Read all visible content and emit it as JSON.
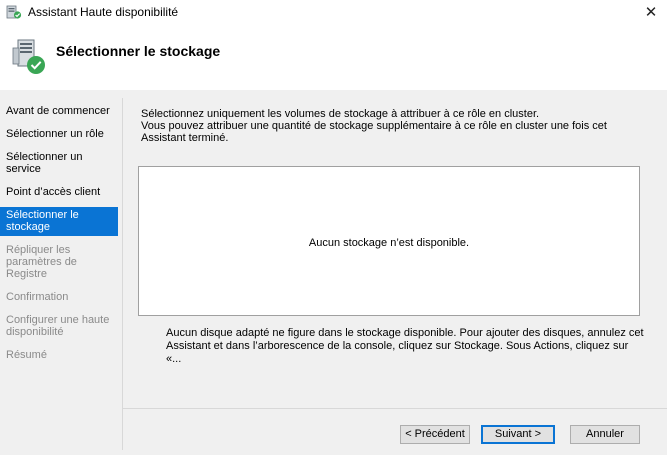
{
  "window": {
    "title": "Assistant Haute disponibilité",
    "close_glyph": "✕",
    "icon": "cluster-wizard-icon"
  },
  "header": {
    "title": "Sélectionner le stockage",
    "icon": "storage-wizard-icon"
  },
  "sidebar": {
    "items": [
      {
        "label": "Avant de commencer",
        "state": "normal"
      },
      {
        "label": "Sélectionner un rôle",
        "state": "normal"
      },
      {
        "label": "Sélectionner un service",
        "state": "normal"
      },
      {
        "label": "Point d’accès client",
        "state": "normal"
      },
      {
        "label": "Sélectionner le stockage",
        "state": "active"
      },
      {
        "label": "Répliquer les paramètres de Registre",
        "state": "disabled"
      },
      {
        "label": "Confirmation",
        "state": "disabled"
      },
      {
        "label": "Configurer une haute disponibilité",
        "state": "disabled"
      },
      {
        "label": "Résumé",
        "state": "disabled"
      }
    ]
  },
  "main": {
    "intro_line1": "Sélectionnez uniquement les volumes de stockage à attribuer à ce rôle en cluster.",
    "intro_line2": "Vous pouvez attribuer une quantité de stockage supplémentaire à ce rôle en cluster une fois cet Assistant terminé.",
    "storage_empty": "Aucun stockage n’est disponible.",
    "help_text": "Aucun disque adapté ne figure dans le stockage disponible. Pour ajouter des disques, annulez cet Assistant et dans l’arborescence de la console, cliquez sur Stockage. Sous Actions, cliquez sur «..."
  },
  "footer": {
    "prev_label": "< Précédent",
    "next_label": "Suivant >",
    "cancel_label": "Annuler"
  },
  "colors": {
    "accent": "#0a74d4",
    "background": "#f0f0f0",
    "disabled_text": "#8a8a8a"
  }
}
